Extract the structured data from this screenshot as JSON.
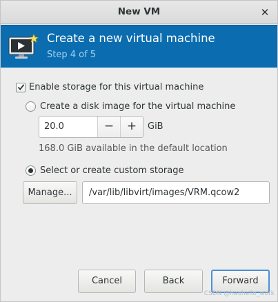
{
  "window": {
    "title": "New VM"
  },
  "header": {
    "title": "Create a new virtual machine",
    "step": "Step 4 of 5",
    "icon": "vm-monitor-icon",
    "background": "#0b6db0"
  },
  "storage": {
    "enable_label": "Enable storage for this virtual machine",
    "enable_checked": true,
    "disk_image_label": "Create a disk image for the virtual machine",
    "disk_image_selected": false,
    "size_value": "20.0",
    "size_unit": "GiB",
    "available_text": "168.0 GiB available in the default location",
    "custom_label": "Select or create custom storage",
    "custom_selected": true,
    "manage_label": "Manage...",
    "path_value": "/var/lib/libvirt/images/VRM.qcow2"
  },
  "footer": {
    "cancel_label": "Cancel",
    "back_label": "Back",
    "forward_label": "Forward"
  },
  "watermark": "CSDN @haohailo_work"
}
